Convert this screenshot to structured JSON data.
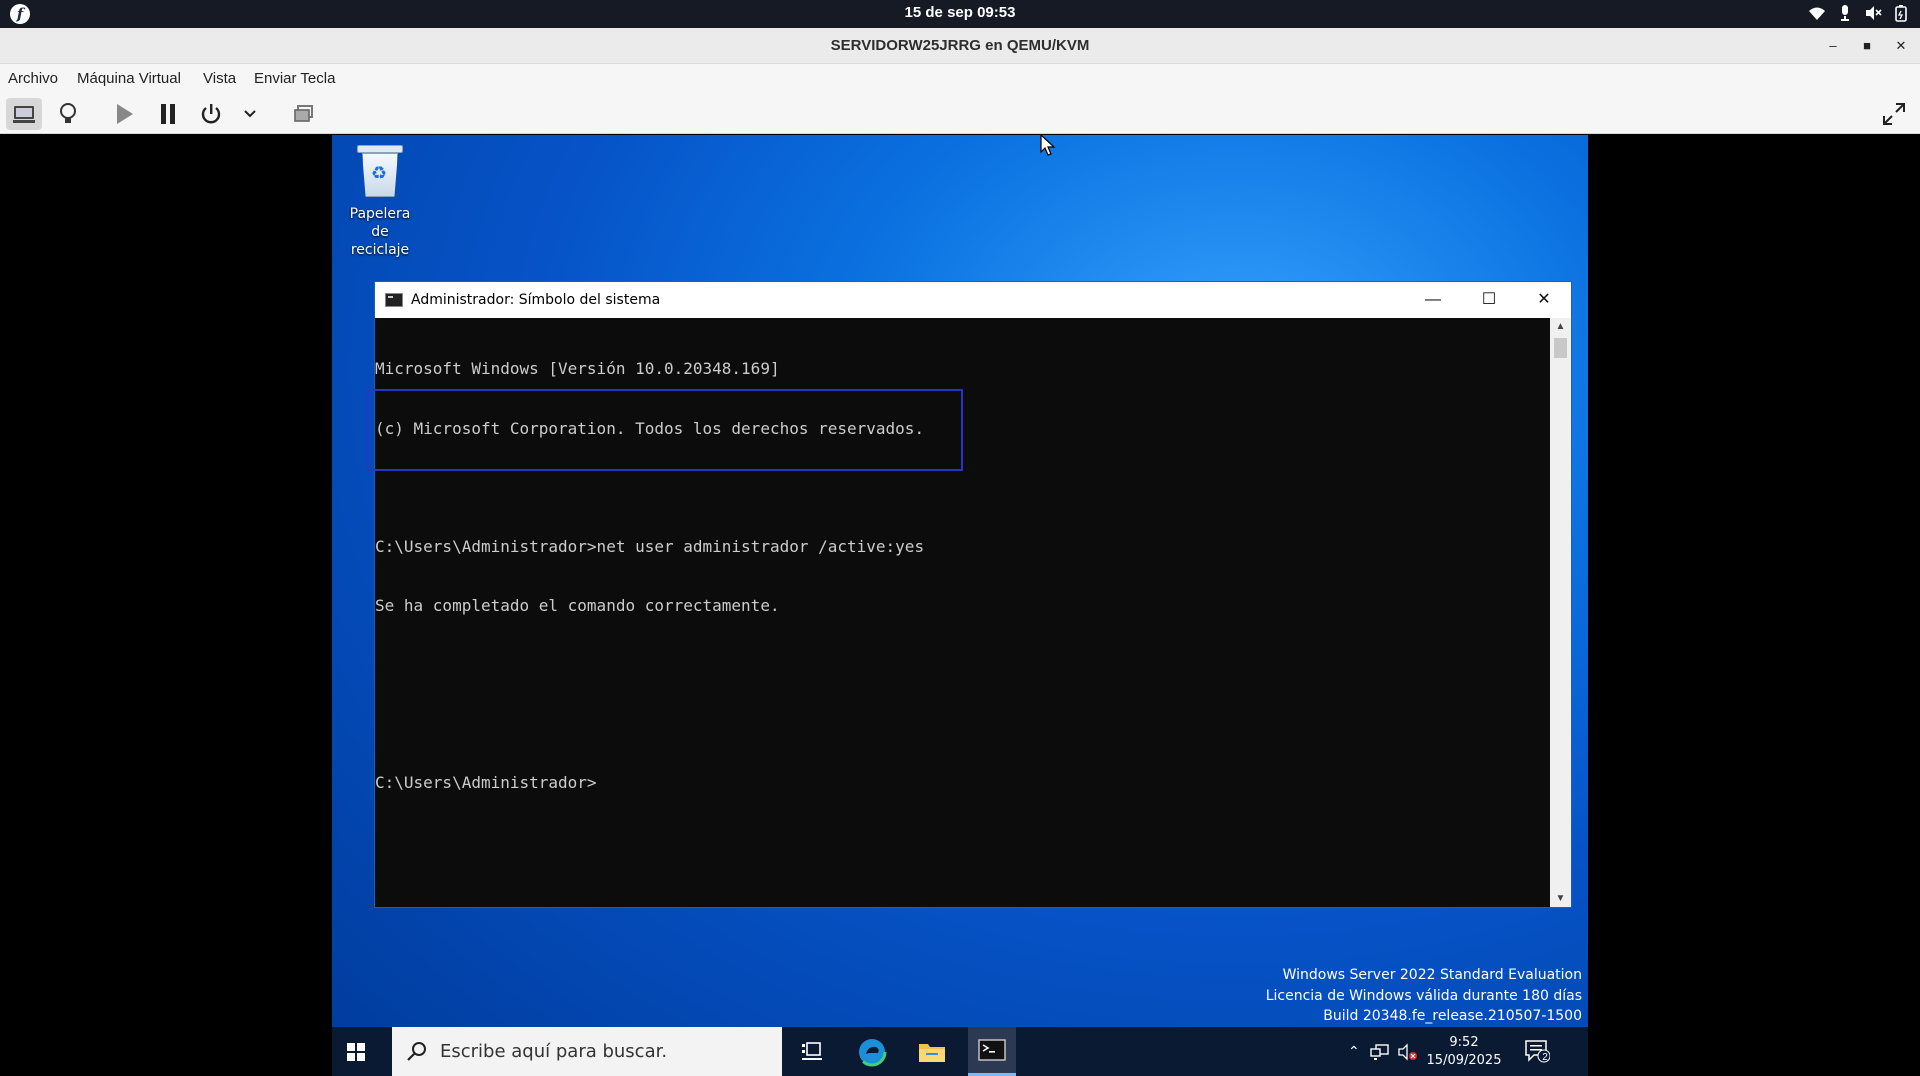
{
  "gnome_topbar": {
    "clock": "15 de sep  09:53",
    "tray_icons": [
      "wifi-icon",
      "mic-icon",
      "volume-muted-icon",
      "battery-icon"
    ]
  },
  "window": {
    "title": "SERVIDORW25JRRG en QEMU/KVM",
    "controls": [
      "minimize",
      "maximize",
      "close"
    ]
  },
  "menubar": {
    "items": [
      "Archivo",
      "Máquina Virtual",
      "Vista",
      "Enviar Tecla"
    ]
  },
  "toolbar": {
    "buttons": [
      "console-view-icon",
      "details-bulb-icon",
      "run-icon",
      "pause-icon",
      "power-icon",
      "chevron-down-icon",
      "snapshots-icon",
      "fullscreen-icon"
    ]
  },
  "vm": {
    "desktop_icon": {
      "label_line1": "Papelera de",
      "label_line2": "reciclaje"
    },
    "cmd": {
      "title": "Administrador: Símbolo del sistema",
      "lines": [
        "Microsoft Windows [Versión 10.0.20348.169]",
        "(c) Microsoft Corporation. Todos los derechos reservados.",
        "",
        "C:\\Users\\Administrador>net user administrador /active:yes",
        "Se ha completado el comando correctamente.",
        "",
        "",
        "C:\\Users\\Administrador>"
      ]
    },
    "watermark": {
      "line1": "Windows Server 2022 Standard Evaluation",
      "line2": "Licencia de Windows válida durante 180 días",
      "line3": "Build 20348.fe_release.210507-1500"
    },
    "taskbar": {
      "search_placeholder": "Escribe aquí para buscar.",
      "time": "9:52",
      "date": "15/09/2025",
      "notification_count": "2"
    }
  }
}
